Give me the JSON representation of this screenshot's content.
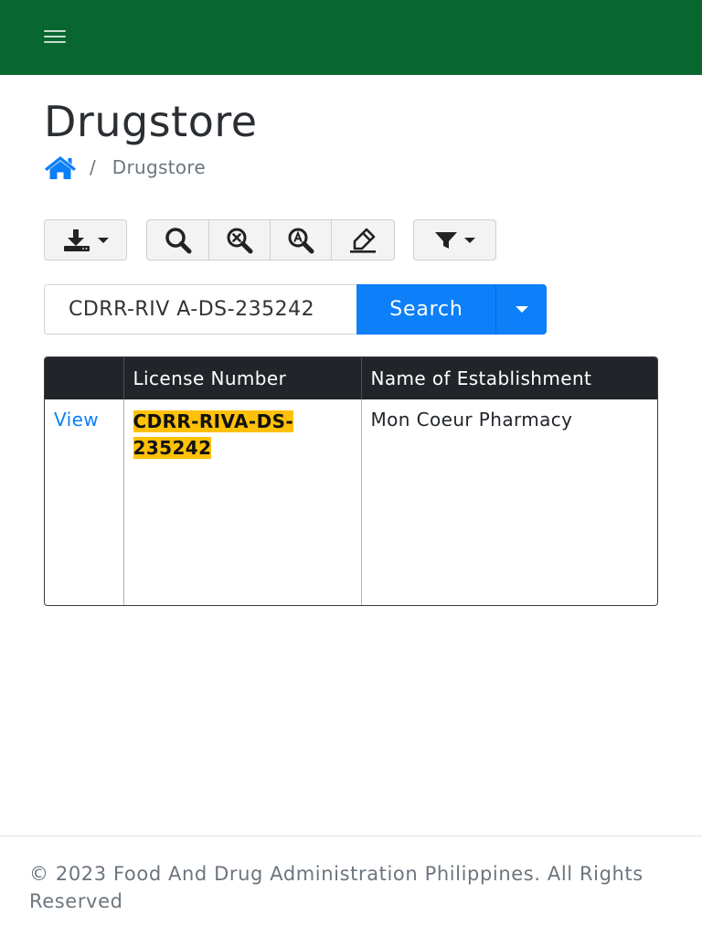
{
  "navbar": {
    "brand_color": "#07672e",
    "menu_icon": "hamburger-menu-icon"
  },
  "page": {
    "title": "Drugstore"
  },
  "breadcrumb": {
    "home_icon": "home-icon",
    "separator": "/",
    "current": "Drugstore"
  },
  "toolbar": {
    "download_icon": "download-icon",
    "search_icons": [
      "magnifier-icon",
      "clear-search-icon",
      "advanced-search-icon",
      "highlight-icon"
    ],
    "filter_icon": "filter-icon"
  },
  "search": {
    "value": "CDRR-RIV A-DS-235242",
    "button_label": "Search",
    "accent_color": "#0d7ff8"
  },
  "table": {
    "columns": [
      "",
      "License Number",
      "Name of Establishment"
    ],
    "rows": [
      {
        "action": "View",
        "license_line1": "CDRR-RIVA-DS-",
        "license_line2": "235242",
        "establishment": "Mon Coeur Pharmacy"
      }
    ],
    "highlight_color": "#ffc107"
  },
  "footer": {
    "copyright": "© 2023 Food And Drug Administration Philippines. All Rights Reserved"
  }
}
